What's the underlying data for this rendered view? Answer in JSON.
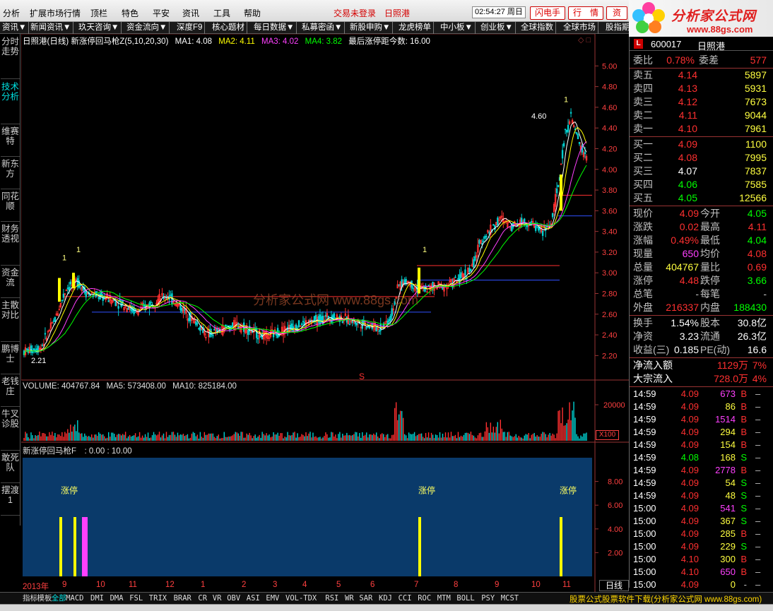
{
  "menu": {
    "items": [
      "分析",
      "扩展市场行情",
      "顶栏",
      "特色",
      "平安",
      "资讯",
      "工具",
      "帮助"
    ],
    "status_login": "交易未登录",
    "status_stock": "日照港",
    "clock": "02:54:27 周日",
    "buttons": [
      "闪电手",
      "行　情",
      "资"
    ]
  },
  "logo": {
    "title": "分析家公式网",
    "url": "www.88gs.com"
  },
  "tabs": [
    "资讯▼",
    "新闻资讯▼",
    "玖天咨询▼",
    "资金流向▼",
    "深度F9",
    "核心题材",
    "每日数据▼",
    "私募密函▼",
    "新股申购▼",
    "龙虎榜单",
    "中小板▼",
    "创业板▼",
    "全球指数",
    "全球市场",
    "股指期"
  ],
  "sidebar": [
    "分时走势",
    "技术分析",
    "维赛特",
    "新东方",
    "同花顺",
    "财务透视",
    "资金流",
    "主散对比",
    "鹏博士",
    "老钱庄",
    "牛叉诊股",
    "敢死队",
    "摆渡1"
  ],
  "chart_info": {
    "title": "日照港(日线) 新涨停回马枪Z(5,10,20,30)",
    "ma1_label": "MA1: 4.08",
    "ma2_label": "MA2: 4.11",
    "ma3_label": "MA3: 4.02",
    "ma4_label": "MA4: 3.82",
    "last_label": "最后涨停距今数: 16.00"
  },
  "volume_info": {
    "vol": "VOLUME: 404767.84",
    "ma5": "MA5: 573408.00",
    "ma10": "MA10: 825184.00"
  },
  "indicator_info": "新涨停回马枪F　: 0.00 : 10.00",
  "watermark": "分析家公式网 www.88gs.com",
  "price_axis": [
    "5.00",
    "4.80",
    "4.60",
    "4.40",
    "4.20",
    "4.00",
    "3.80",
    "3.60",
    "3.40",
    "3.20",
    "3.00",
    "2.80",
    "2.60",
    "2.40",
    "2.20"
  ],
  "volume_axis": [
    "20000"
  ],
  "indicator_axis": [
    "8.00",
    "6.00",
    "4.00",
    "2.00"
  ],
  "x100": "X100",
  "price_markers": {
    "low": "2.21",
    "high": "4.60",
    "s_marker": "S"
  },
  "chart_data": {
    "type": "candlestick",
    "title": "日照港(日线)",
    "ylim": [
      2.1,
      5.05
    ],
    "key_values": {
      "low": 2.21,
      "high": 4.6
    },
    "ma": {
      "MA1": 4.08,
      "MA2": 4.11,
      "MA3": 4.02,
      "MA4": 3.82
    },
    "volume": 404767.84,
    "volume_ma5": 573408.0,
    "volume_ma10": 825184.0,
    "signal_labels": [
      "涨停",
      "涨停",
      "涨停"
    ],
    "x_ticks": [
      "2013年",
      "9",
      "10",
      "11",
      "12",
      "1",
      "2",
      "3",
      "4",
      "5",
      "6",
      "7",
      "8",
      "9",
      "10",
      "11"
    ]
  },
  "panel": {
    "code": "600017",
    "name": "日照港",
    "weibi_label": "委比",
    "weibi": "0.78%",
    "weicha_label": "委差",
    "weicha": "577",
    "sells": [
      {
        "label": "卖五",
        "price": "4.14",
        "vol": "5897"
      },
      {
        "label": "卖四",
        "price": "4.13",
        "vol": "5931"
      },
      {
        "label": "卖三",
        "price": "4.12",
        "vol": "7673"
      },
      {
        "label": "卖二",
        "price": "4.11",
        "vol": "9044"
      },
      {
        "label": "卖一",
        "price": "4.10",
        "vol": "7961"
      }
    ],
    "buys": [
      {
        "label": "买一",
        "price": "4.09",
        "vol": "1100"
      },
      {
        "label": "买二",
        "price": "4.08",
        "vol": "7995"
      },
      {
        "label": "买三",
        "price": "4.07",
        "vol": "7837"
      },
      {
        "label": "买四",
        "price": "4.06",
        "vol": "7585"
      },
      {
        "label": "买五",
        "price": "4.05",
        "vol": "12566"
      }
    ],
    "stats": [
      {
        "l1": "现价",
        "v1": "4.09",
        "l2": "今开",
        "v2": "4.05"
      },
      {
        "l1": "涨跌",
        "v1": "0.02",
        "l2": "最高",
        "v2": "4.11"
      },
      {
        "l1": "涨幅",
        "v1": "0.49%",
        "l2": "最低",
        "v2": "4.04"
      },
      {
        "l1": "现量",
        "v1": "650",
        "l2": "均价",
        "v2": "4.08"
      },
      {
        "l1": "总量",
        "v1": "404767",
        "l2": "量比",
        "v2": "0.69"
      },
      {
        "l1": "涨停",
        "v1": "4.48",
        "l2": "跌停",
        "v2": "3.66"
      },
      {
        "l1": "总笔",
        "v1": "-",
        "l2": "每笔",
        "v2": "-"
      },
      {
        "l1": "外盘",
        "v1": "216337",
        "l2": "内盘",
        "v2": "188430"
      }
    ],
    "stats2": [
      {
        "l1": "换手",
        "v1": "1.54%",
        "l2": "股本",
        "v2": "30.8亿"
      },
      {
        "l1": "净资",
        "v1": "3.23",
        "l2": "流通",
        "v2": "26.3亿"
      },
      {
        "l1": "收益(三)",
        "v1": "0.185",
        "l2": "PE(动)",
        "v2": "16.6"
      }
    ],
    "flow": [
      {
        "label": "净流入额",
        "value": "1129万",
        "pct": "7%"
      },
      {
        "label": "大宗流入",
        "value": "728.0万",
        "pct": "4%"
      }
    ],
    "ticks": [
      {
        "t": "14:59",
        "p": "4.09",
        "v": "673",
        "s": "B"
      },
      {
        "t": "14:59",
        "p": "4.09",
        "v": "86",
        "s": "B"
      },
      {
        "t": "14:59",
        "p": "4.09",
        "v": "1514",
        "s": "B"
      },
      {
        "t": "14:59",
        "p": "4.09",
        "v": "294",
        "s": "B"
      },
      {
        "t": "14:59",
        "p": "4.09",
        "v": "154",
        "s": "B"
      },
      {
        "t": "14:59",
        "p": "4.08",
        "v": "168",
        "s": "S"
      },
      {
        "t": "14:59",
        "p": "4.09",
        "v": "2778",
        "s": "B"
      },
      {
        "t": "14:59",
        "p": "4.09",
        "v": "54",
        "s": "S"
      },
      {
        "t": "14:59",
        "p": "4.09",
        "v": "48",
        "s": "S"
      },
      {
        "t": "15:00",
        "p": "4.09",
        "v": "541",
        "s": "S"
      },
      {
        "t": "15:00",
        "p": "4.09",
        "v": "367",
        "s": "S"
      },
      {
        "t": "15:00",
        "p": "4.09",
        "v": "285",
        "s": "B"
      },
      {
        "t": "15:00",
        "p": "4.09",
        "v": "229",
        "s": "S"
      },
      {
        "t": "15:00",
        "p": "4.10",
        "v": "300",
        "s": "B"
      },
      {
        "t": "15:00",
        "p": "4.10",
        "v": "650",
        "s": "B"
      },
      {
        "t": "15:00",
        "p": "4.09",
        "v": "0",
        "s": "-"
      }
    ]
  },
  "day_tab": "日线",
  "bottom_tabs": [
    "指标",
    "模板",
    "全部",
    "MACD",
    "DMI",
    "DMA",
    "FSL",
    "TRIX",
    "BRAR",
    "CR",
    "VR",
    "OBV",
    "ASI",
    "EMV",
    "VOL-TDX",
    "RSI",
    "WR",
    "SAR",
    "KDJ",
    "CCI",
    "ROC",
    "MTM",
    "BOLL",
    "PSY",
    "MCST"
  ],
  "bottom_ad": "股票公式股票软件下载(分析家公式网 www.88gs.com)",
  "colors": {
    "up": "#ff3030",
    "down": "#00d0d0",
    "ma1": "#ffffff",
    "ma2": "#ffff00",
    "ma3": "#ff40ff",
    "ma4": "#00ff00",
    "indicator_bg": "#0a3a6a"
  }
}
